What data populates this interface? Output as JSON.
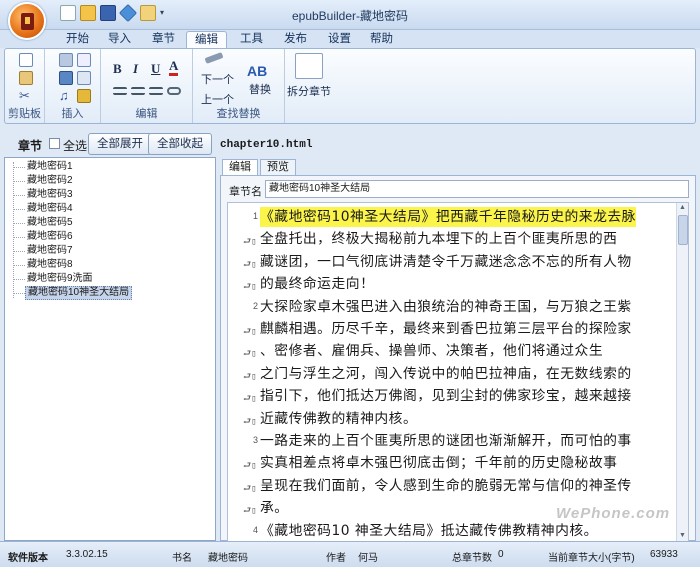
{
  "window": {
    "title": "epubBuilder-藏地密码"
  },
  "quick_access": [
    "new-icon",
    "open-icon",
    "save-icon",
    "publish-icon",
    "bookmark-icon",
    "dropdown-icon"
  ],
  "menu": {
    "tabs": [
      "开始",
      "导入",
      "章节",
      "编辑",
      "工具",
      "发布",
      "设置",
      "帮助"
    ],
    "active": "编辑"
  },
  "ribbon": {
    "groups": {
      "clipboard": "剪贴板",
      "insert": "插入",
      "edit": "编辑",
      "find_replace": "查找替换"
    },
    "format_buttons": [
      "B",
      "I",
      "U",
      "A"
    ],
    "find_next": "下一个",
    "find_prev": "上一个",
    "replace": "替换",
    "replace_icon_text": "AB",
    "split_chapter": "拆分章节"
  },
  "chapter_toolbar": {
    "label": "章节",
    "select_all": "全选",
    "expand_all": "全部展开",
    "collapse_all": "全部收起",
    "filename": "chapter10.html"
  },
  "tree": {
    "items": [
      "藏地密码1",
      "藏地密码2",
      "藏地密码3",
      "藏地密码4",
      "藏地密码5",
      "藏地密码6",
      "藏地密码7",
      "藏地密码8",
      "藏地密码9洗面",
      "藏地密码10神圣大结局"
    ],
    "selected_index": 9
  },
  "editor": {
    "tabs": [
      "编辑",
      "预览"
    ],
    "active_tab": "编辑",
    "chapter_name_label": "章节名",
    "chapter_name_value": "藏地密码10神圣大结局",
    "lines": [
      {
        "num": "1",
        "text": "《藏地密码10神圣大结局》把西藏千年隐秘历史的来龙去脉",
        "highlight": true
      },
      {
        "num": "",
        "text": "全盘托出，终极大揭秘前九本埋下的上百个匪夷所思的西"
      },
      {
        "num": "",
        "text": "藏谜团，一口气彻底讲清楚令千万藏迷念念不忘的所有人物"
      },
      {
        "num": "",
        "text": "的最终命运走向！"
      },
      {
        "num": "2",
        "text": "大探险家卓木强巴进入由狼统治的神奇王国，与万狼之王紫"
      },
      {
        "num": "",
        "text": "麒麟相遇。历尽千辛，最终来到香巴拉第三层平台的探险家"
      },
      {
        "num": "",
        "text": "、密修者、雇佣兵、操兽师、决策者，他们将通过众生"
      },
      {
        "num": "",
        "text": "之门与浮生之河，闯入传说中的帕巴拉神庙，在无数线索的"
      },
      {
        "num": "",
        "text": "指引下，他们抵达万佛阁，见到尘封的佛家珍宝，越来越接"
      },
      {
        "num": "",
        "text": "近藏传佛教的精神内核。"
      },
      {
        "num": "3",
        "text": "一路走来的上百个匪夷所思的谜团也渐渐解开，而可怕的事"
      },
      {
        "num": "",
        "text": "实真相差点将卓木强巴彻底击倒；千年前的历史隐秘故事"
      },
      {
        "num": "",
        "text": "呈现在我们面前，令人感到生命的脆弱无常与信仰的神圣传"
      },
      {
        "num": "",
        "text": "承。"
      },
      {
        "num": "4",
        "text": "《藏地密码10 神圣大结局》抵达藏传佛教精神内核。"
      }
    ]
  },
  "watermark": "WePhone.com",
  "status": {
    "label": "软件版本",
    "version": "3.3.02.15",
    "book_label": "书名",
    "book_value": "藏地密码",
    "author_label": "作者",
    "author_value": "何马",
    "total_label": "总章节数",
    "total_value": "0",
    "size_label": "当前章节大小(字节)",
    "size_value": "63933"
  },
  "colors": {
    "highlight": "#fbf44a",
    "ribbon_bg": "#e2ecf8",
    "selected_tree": "#c5d4ea"
  }
}
